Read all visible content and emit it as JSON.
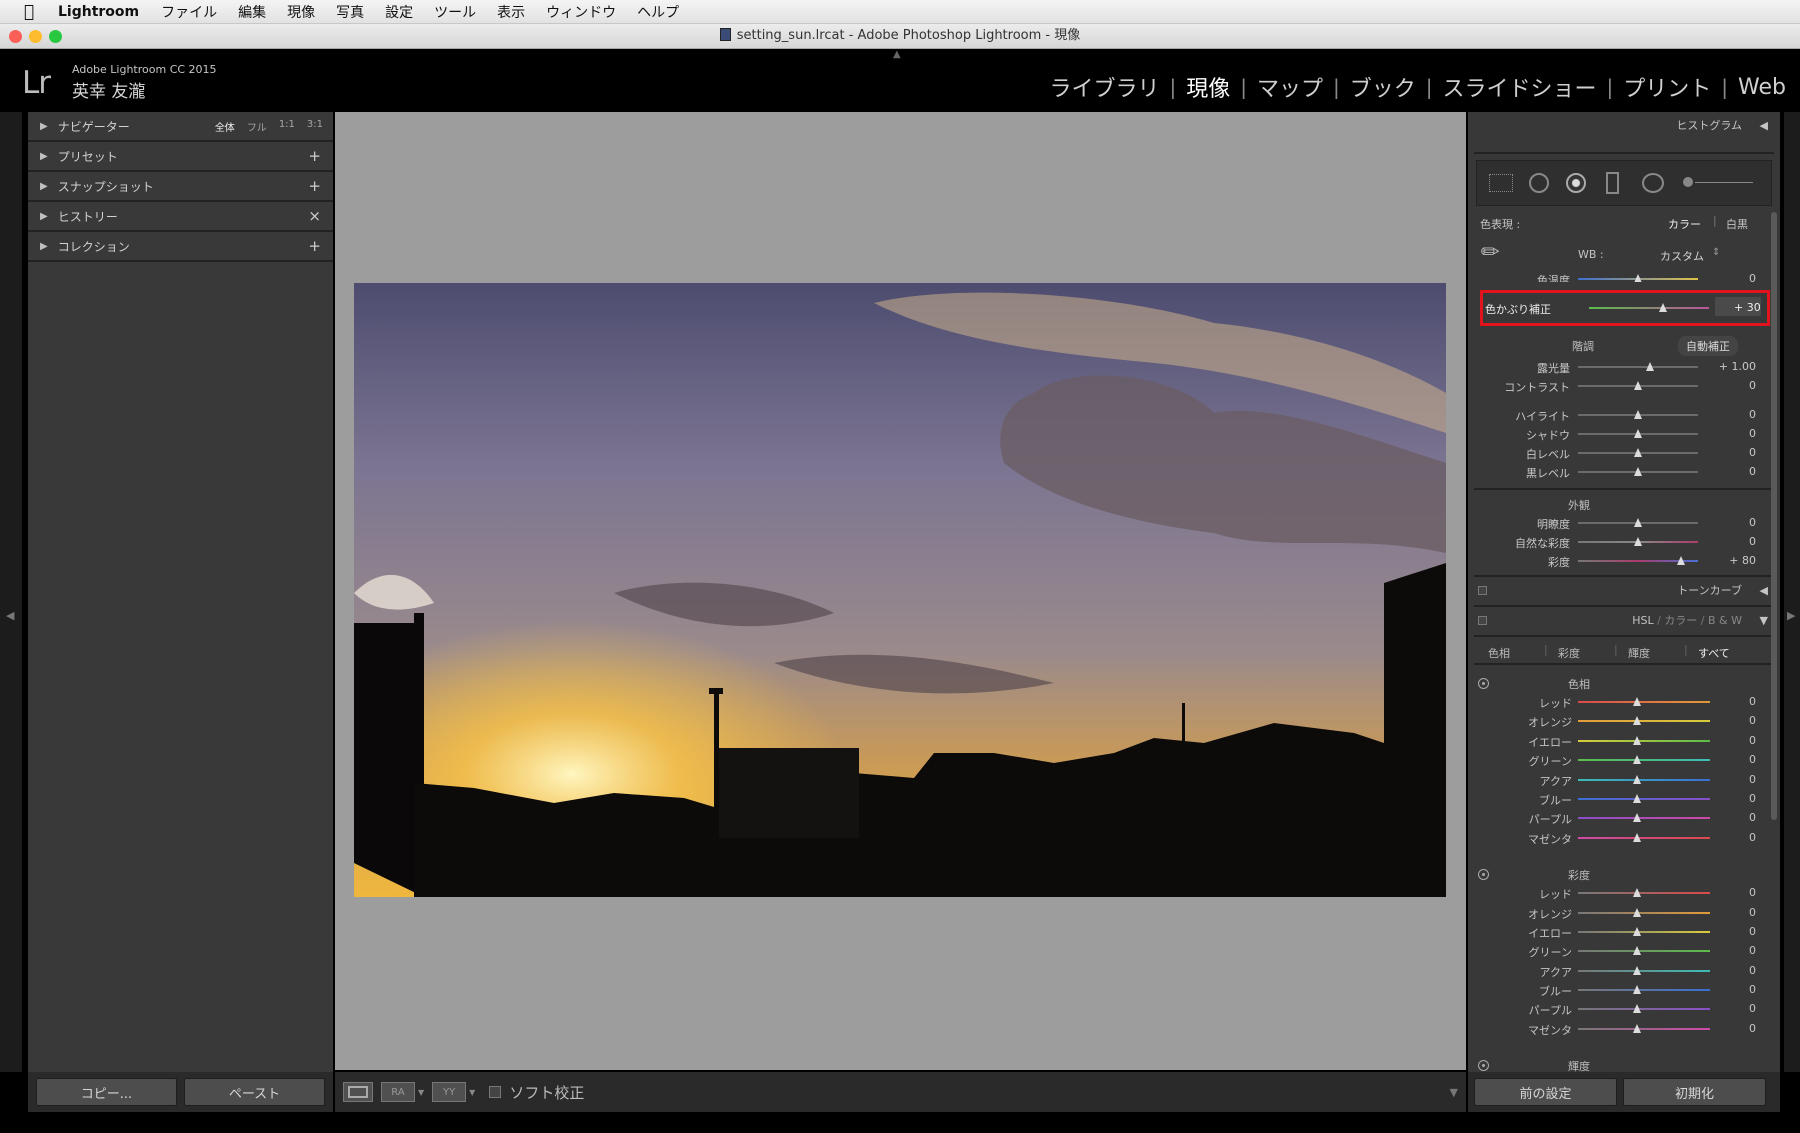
{
  "menubar": {
    "app_name": "Lightroom",
    "items": [
      "ファイル",
      "編集",
      "現像",
      "写真",
      "設定",
      "ツール",
      "表示",
      "ウィンドウ",
      "ヘルプ"
    ]
  },
  "window": {
    "title": "setting_sun.lrcat - Adobe Photoshop Lightroom - 現像",
    "colors": {
      "close": "#fc5f57",
      "minimize": "#fdbc2e",
      "zoom": "#28c840"
    }
  },
  "header": {
    "logo": "Lr",
    "product": "Adobe Lightroom CC 2015",
    "user": "英幸 友瀧",
    "modules": [
      "ライブラリ",
      "現像",
      "マップ",
      "ブック",
      "スライドショー",
      "プリント",
      "Web"
    ],
    "active_module": "現像"
  },
  "left_panel": {
    "navigator": {
      "label": "ナビゲーター",
      "options": [
        "全体",
        "フル",
        "1:1",
        "3:1"
      ]
    },
    "rows": [
      {
        "label": "プリセット",
        "action": "+"
      },
      {
        "label": "スナップショット",
        "action": "+"
      },
      {
        "label": "ヒストリー",
        "action": "×"
      },
      {
        "label": "コレクション",
        "action": "+"
      }
    ],
    "copy_button": "コピー...",
    "paste_button": "ペースト"
  },
  "toolbar": {
    "softproof_label": "ソフト校正",
    "before_after_a": "RA",
    "before_after_b": "YY"
  },
  "right_panel": {
    "histogram_label": "ヒストグラム",
    "basic": {
      "treatment_label": "色表現 :",
      "treatment_color": "カラー",
      "treatment_bw": "白黒",
      "wb_label": "WB :",
      "wb_value": "カスタム",
      "temp_label": "色温度",
      "temp_value": "0",
      "tint_label": "色かぶり補正",
      "tint_value": "+ 30",
      "tint_position": 0.62,
      "tone_label": "階調",
      "auto_label": "自動補正",
      "sliders": [
        {
          "label": "露光量",
          "value": "+ 1.00",
          "pos": 0.6
        },
        {
          "label": "コントラスト",
          "value": "0",
          "pos": 0.5
        }
      ],
      "tone_sliders": [
        {
          "label": "ハイライト",
          "value": "0",
          "pos": 0.5
        },
        {
          "label": "シャドウ",
          "value": "0",
          "pos": 0.5
        },
        {
          "label": "白レベル",
          "value": "0",
          "pos": 0.5
        },
        {
          "label": "黒レベル",
          "value": "0",
          "pos": 0.5
        }
      ],
      "presence_label": "外観",
      "presence_sliders": [
        {
          "label": "明瞭度",
          "value": "0",
          "pos": 0.5
        },
        {
          "label": "自然な彩度",
          "value": "0",
          "pos": 0.5
        },
        {
          "label": "彩度",
          "value": "+ 80",
          "pos": 0.86
        }
      ]
    },
    "tone_curve_label": "トーンカーブ",
    "hsl": {
      "header": [
        "HSL",
        "カラー",
        "B & W"
      ],
      "tabs": [
        "色相",
        "彩度",
        "輝度",
        "すべて"
      ],
      "hue_title": "色相",
      "sat_title": "彩度",
      "lum_title": "輝度",
      "colors": [
        {
          "label": "レッド",
          "value": "0",
          "hex": "#d94b4b"
        },
        {
          "label": "オレンジ",
          "value": "0",
          "hex": "#e39a3b"
        },
        {
          "label": "イエロー",
          "value": "0",
          "hex": "#d8cd3c"
        },
        {
          "label": "グリーン",
          "value": "0",
          "hex": "#5bbd4a"
        },
        {
          "label": "アクア",
          "value": "0",
          "hex": "#3cbcb6"
        },
        {
          "label": "ブルー",
          "value": "0",
          "hex": "#3a6fd3"
        },
        {
          "label": "パープル",
          "value": "0",
          "hex": "#8a4fc8"
        },
        {
          "label": "マゼンタ",
          "value": "0",
          "hex": "#cd4aa6"
        }
      ]
    },
    "prev_button": "前の設定",
    "reset_button": "初期化"
  }
}
